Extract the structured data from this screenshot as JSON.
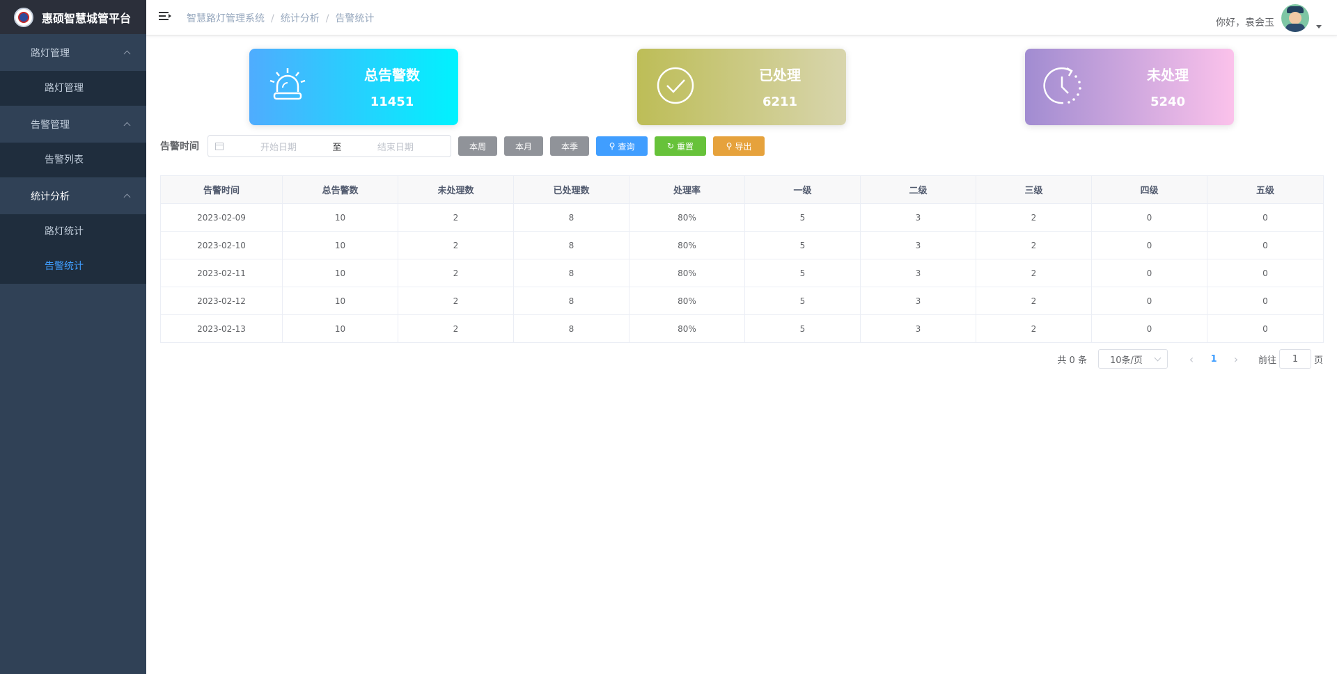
{
  "app": {
    "title": "惠硕智慧城管平台"
  },
  "sidebar": {
    "groups": [
      {
        "label": "路灯管理",
        "items": [
          {
            "label": "路灯管理",
            "active": false
          }
        ]
      },
      {
        "label": "告警管理",
        "items": [
          {
            "label": "告警列表",
            "active": false
          }
        ]
      },
      {
        "label": "统计分析",
        "items": [
          {
            "label": "路灯统计",
            "active": false
          },
          {
            "label": "告警统计",
            "active": true
          }
        ]
      }
    ]
  },
  "header": {
    "breadcrumb": [
      "智慧路灯管理系统",
      "统计分析",
      "告警统计"
    ],
    "greeting": "你好，袁会玉"
  },
  "stats": {
    "total": {
      "label": "总告警数",
      "value": "11451"
    },
    "processed": {
      "label": "已处理",
      "value": "6211"
    },
    "unprocessed": {
      "label": "未处理",
      "value": "5240"
    }
  },
  "filter": {
    "label": "告警时间",
    "start_placeholder": "开始日期",
    "separator": "至",
    "end_placeholder": "结束日期",
    "buttons": {
      "week": "本周",
      "month": "本月",
      "quarter": "本季",
      "query": "查询",
      "reset": "重置",
      "export": "导出"
    }
  },
  "table": {
    "columns": [
      "告警时间",
      "总告警数",
      "未处理数",
      "已处理数",
      "处理率",
      "一级",
      "二级",
      "三级",
      "四级",
      "五级"
    ],
    "rows": [
      [
        "2023-02-09",
        "10",
        "2",
        "8",
        "80%",
        "5",
        "3",
        "2",
        "0",
        "0"
      ],
      [
        "2023-02-10",
        "10",
        "2",
        "8",
        "80%",
        "5",
        "3",
        "2",
        "0",
        "0"
      ],
      [
        "2023-02-11",
        "10",
        "2",
        "8",
        "80%",
        "5",
        "3",
        "2",
        "0",
        "0"
      ],
      [
        "2023-02-12",
        "10",
        "2",
        "8",
        "80%",
        "5",
        "3",
        "2",
        "0",
        "0"
      ],
      [
        "2023-02-13",
        "10",
        "2",
        "8",
        "80%",
        "5",
        "3",
        "2",
        "0",
        "0"
      ]
    ]
  },
  "pagination": {
    "total_text": "共 0 条",
    "page_size": "10条/页",
    "current_page": "1",
    "goto_prefix": "前往",
    "goto_value": "1",
    "goto_suffix": "页"
  },
  "colors": {
    "sidebar_bg": "#304156",
    "submenu_bg": "#1f2d3d",
    "active_text": "#409eff"
  }
}
